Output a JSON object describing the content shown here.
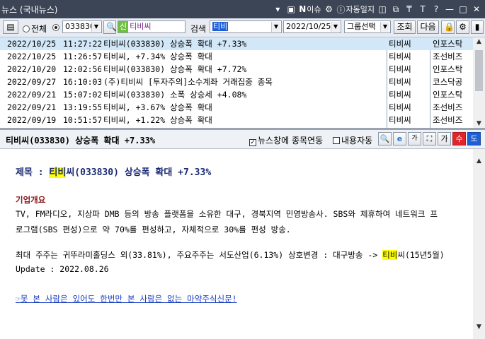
{
  "window": {
    "title": "뉴스 (국내뉴스)"
  },
  "titlebar_icons": [
    {
      "name": "menu-icon",
      "glyph": "▾"
    },
    {
      "name": "monitor-icon",
      "glyph": "▣"
    },
    {
      "name": "news-issue-icon",
      "glyph": "N",
      "label": "이슈"
    },
    {
      "name": "auto-news-icon",
      "glyph": "⚙"
    },
    {
      "name": "auto-journal-icon",
      "glyph": "ⓘ",
      "label": "자동일지"
    },
    {
      "name": "restore-icon",
      "glyph": "◫"
    },
    {
      "name": "tile-icon",
      "glyph": "⧉"
    },
    {
      "name": "pin-icon",
      "glyph": "₸"
    },
    {
      "name": "font-icon",
      "glyph": "T"
    },
    {
      "name": "help-icon",
      "glyph": "?"
    },
    {
      "name": "minimize-icon",
      "glyph": "—"
    },
    {
      "name": "maximize-icon",
      "glyph": "□"
    },
    {
      "name": "close-icon",
      "glyph": "✕"
    }
  ],
  "toolbar": {
    "scope_all": "전체",
    "stock_code": "033830",
    "stock_badge": "신",
    "stock_name": "티비씨",
    "search_label": "검색",
    "search_value": "티비",
    "date": "2022/10/25",
    "group_select": "그룹선택",
    "query_button": "조회",
    "next_button": "다음"
  },
  "news_list": [
    {
      "date": "2022/10/25",
      "time": "11:27:22",
      "title": "티비씨(033830) 상승폭 확대 +7.33%",
      "stock": "티비씨",
      "source": "인포스탁"
    },
    {
      "date": "2022/10/25",
      "time": "11:26:57",
      "title": "티비씨, +7.34% 상승폭 확대",
      "stock": "티비씨",
      "source": "조선비즈"
    },
    {
      "date": "2022/10/20",
      "time": "12:02:56",
      "title": "티비씨(033830) 상승폭 확대 +7.72%",
      "stock": "티비씨",
      "source": "인포스탁"
    },
    {
      "date": "2022/09/27",
      "time": "16:10:03",
      "title": "(주)티비씨 [투자주의]소수계좌 거래집중 종목",
      "stock": "티비씨",
      "source": "코스닥공"
    },
    {
      "date": "2022/09/21",
      "time": "15:07:02",
      "title": "티비씨(033830) 소폭 상승세 +4.08%",
      "stock": "티비씨",
      "source": "인포스탁"
    },
    {
      "date": "2022/09/21",
      "time": "13:19:55",
      "title": "티비씨, +3.67% 상승폭 확대",
      "stock": "티비씨",
      "source": "조선비즈"
    },
    {
      "date": "2022/09/19",
      "time": "10:51:57",
      "title": "티비씨, +1.22% 상승폭 확대",
      "stock": "티비씨",
      "source": "조선비즈"
    }
  ],
  "viewer": {
    "title": "티비씨(033830) 상승폭 확대 +7.33%",
    "news_link_label": "뉴스창에 종목연동",
    "content_link_label": "내용자동",
    "checkbox_news_link": true,
    "checkbox_content_auto": false,
    "button_labels": {
      "font_large": "가",
      "up": "수",
      "down": "도"
    }
  },
  "article": {
    "headline_prefix": "제목 : ",
    "headline_hl": "티비",
    "headline_rest": "씨(033830) 상승폭 확대 +7.33%",
    "section_title": "기업개요",
    "overview_line1": "TV, FM라디오, 지상파 DMB 등의 방송 플랫폼을 소유한 대구, 경북지역 민영방송사. SBS와 제휴하여 네트워크 프",
    "overview_line2": "로그램(SBS 편성)으로 약 70%를 편성하고, 자체적으로 30%를 편성 방송.",
    "shareholder_prefix": "최대 주주는 귀뚜라미홀딩스 외(33.81%), 주요주주는 서도산업(6.13%) 상호변경 : 대구방송 -> ",
    "shareholder_hl": "티비",
    "shareholder_suffix": "씨(15년5월)",
    "update": "Update : 2022.08.26",
    "promo_link": "☞못 본 사람은 있어도 한번만 본 사람은 없는 마약주식신문!"
  },
  "colors": {
    "titlebar": "#3c4556",
    "selected_row": "#d2e7f7",
    "highlight": "#ffff00",
    "headline": "#1a2a72",
    "section": "#8a1a1a",
    "link": "#1a3fbf",
    "btn_up": "#e0242a",
    "btn_down": "#1f5fd6"
  }
}
